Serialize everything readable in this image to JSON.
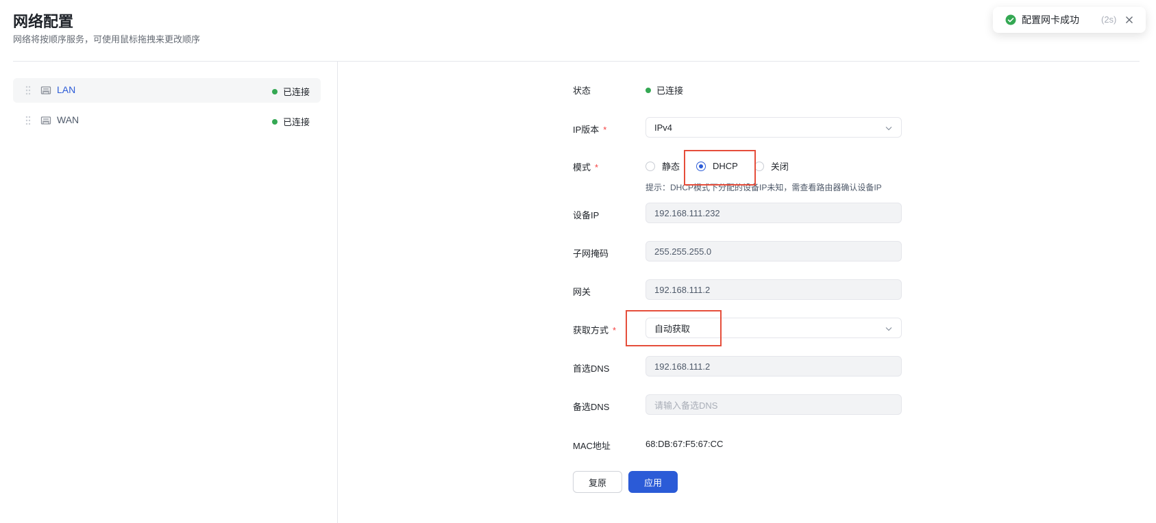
{
  "header": {
    "title": "网络配置",
    "subtitle": "网络将按顺序服务，可使用鼠标拖拽来更改顺序"
  },
  "nics": [
    {
      "name": "LAN",
      "status": "已连接",
      "active": true
    },
    {
      "name": "WAN",
      "status": "已连接",
      "active": false
    }
  ],
  "form": {
    "status_label": "状态",
    "status_value": "已连接",
    "ip_version_label": "IP版本",
    "ip_version_value": "IPv4",
    "mode_label": "模式",
    "mode_options": [
      "静态",
      "DHCP",
      "关闭"
    ],
    "mode_selected": "DHCP",
    "mode_hint": "提示：DHCP模式下分配的设备IP未知，需查看路由器确认设备IP",
    "device_ip_label": "设备IP",
    "device_ip_value": "192.168.111.232",
    "subnet_label": "子网掩码",
    "subnet_value": "255.255.255.0",
    "gateway_label": "网关",
    "gateway_value": "192.168.111.2",
    "acquire_label": "获取方式",
    "acquire_value": "自动获取",
    "dns1_label": "首选DNS",
    "dns1_value": "192.168.111.2",
    "dns2_label": "备选DNS",
    "dns2_placeholder": "请输入备选DNS",
    "mac_label": "MAC地址",
    "mac_value": "68:DB:67:F5:67:CC",
    "required_mark": "*"
  },
  "buttons": {
    "reset": "复原",
    "apply": "应用"
  },
  "toast": {
    "message": "配置网卡成功",
    "countdown": "(2s)"
  },
  "colors": {
    "accent": "#2b5bd7",
    "success": "#34a853",
    "required": "#f53f3f",
    "highlight": "#e54d3a"
  },
  "icons": {
    "drag": "drag-handle-icon",
    "nic": "ethernet-port-icon",
    "chevron": "chevron-down-icon",
    "toast_success": "check-circle-icon",
    "toast_close": "close-icon"
  }
}
